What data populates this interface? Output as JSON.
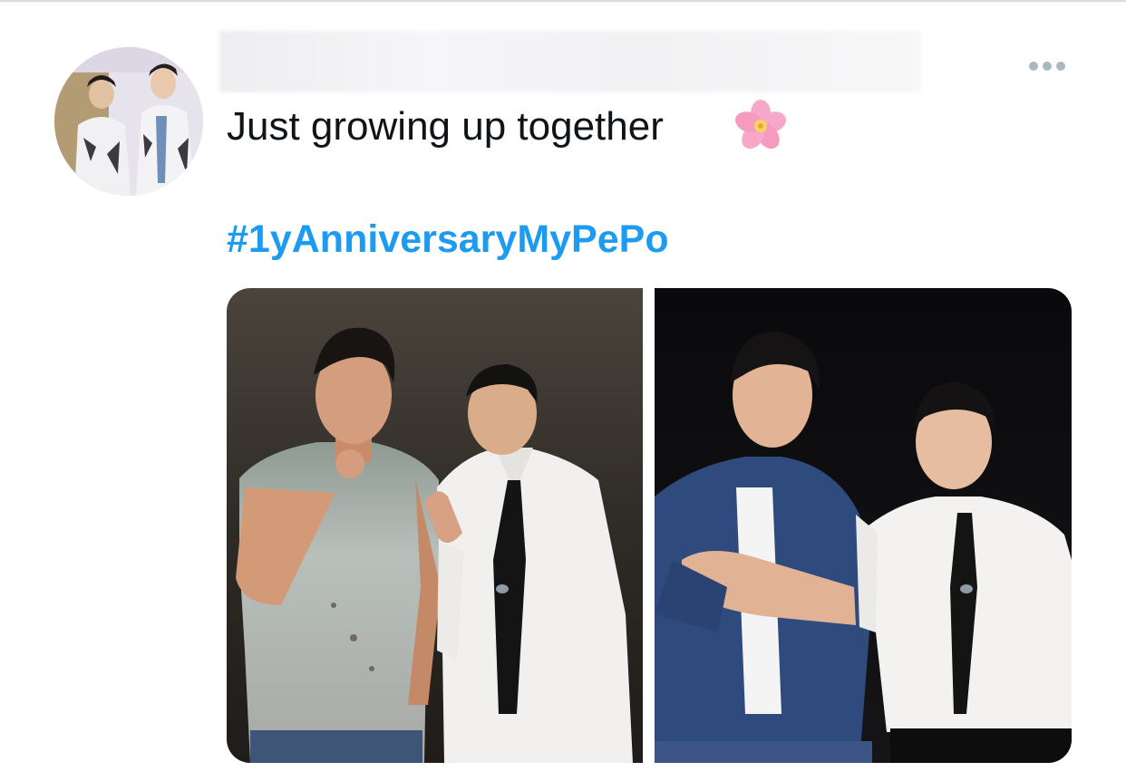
{
  "tweet": {
    "text": "Just growing up together",
    "emoji": "🌸",
    "hashtag": "#1yAnniversaryMyPePo"
  },
  "icons": {
    "more": "more-horizontal-icon",
    "flower": "cherry-blossom-icon"
  },
  "colors": {
    "text": "#0f1419",
    "hashtag": "#1d9bf0",
    "more_icon": "#aab8c2"
  },
  "media": {
    "photo_count": 2
  }
}
